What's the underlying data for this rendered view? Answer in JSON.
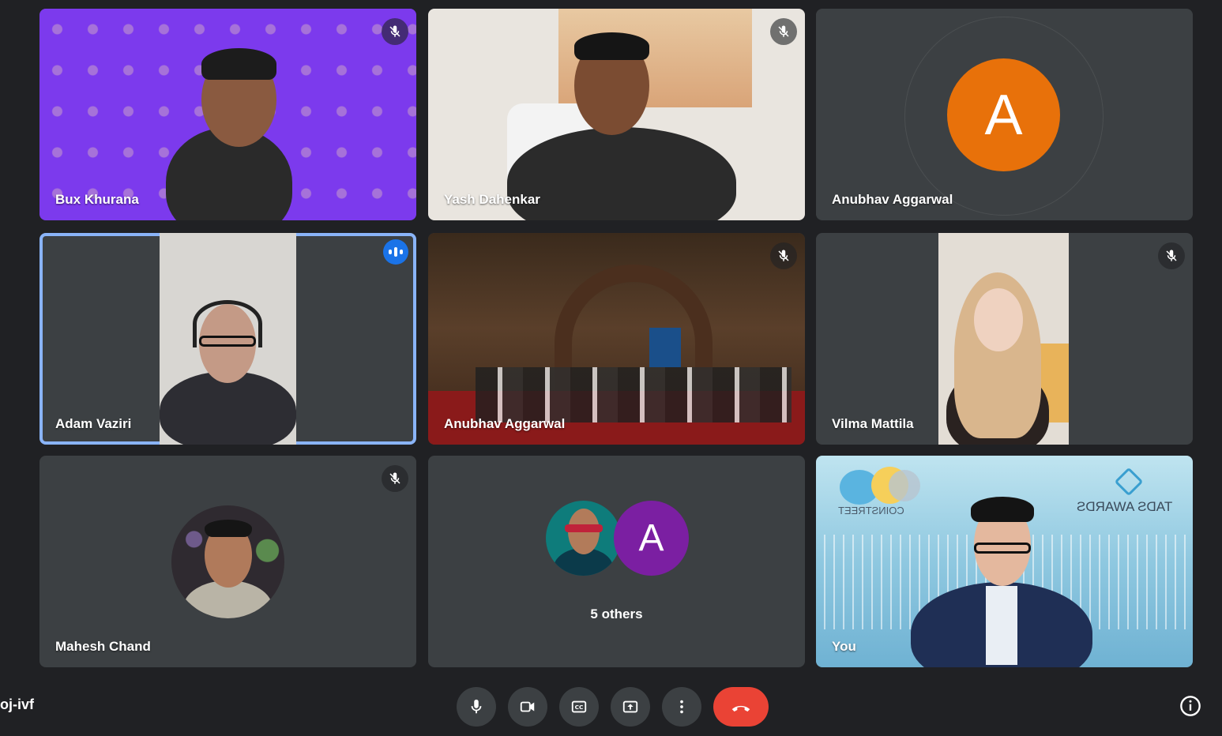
{
  "participants": [
    {
      "name": "Bux Khurana"
    },
    {
      "name": "Yash Dahenkar"
    },
    {
      "name": "Anubhav Aggarwal",
      "avatar_letter": "A"
    },
    {
      "name": "Adam Vaziri"
    },
    {
      "name": "Anubhav Aggarwal"
    },
    {
      "name": "Vilma Mattila"
    },
    {
      "name": "Mahesh Chand"
    },
    {
      "others_label": "5 others",
      "avatar_letter": "A"
    },
    {
      "name": "You"
    }
  ],
  "backgrounds": {
    "coinstreet_text": "COINSTREET",
    "tads_text": "TADS AWARDS"
  },
  "footer": {
    "meeting_code": "oj-ivf"
  },
  "colors": {
    "background": "#202124",
    "tile": "#3c4043",
    "end_call": "#ea4335",
    "speaking": "#8ab4f8",
    "avatar_orange": "#e8710a",
    "avatar_purple": "#7b1fa2"
  },
  "icons": {
    "mic": "mic-icon",
    "camera": "camera-icon",
    "captions": "captions-icon",
    "present": "present-icon",
    "more": "more-vert-icon",
    "end": "call-end-icon",
    "info": "info-icon",
    "muted": "mic-off-icon"
  }
}
